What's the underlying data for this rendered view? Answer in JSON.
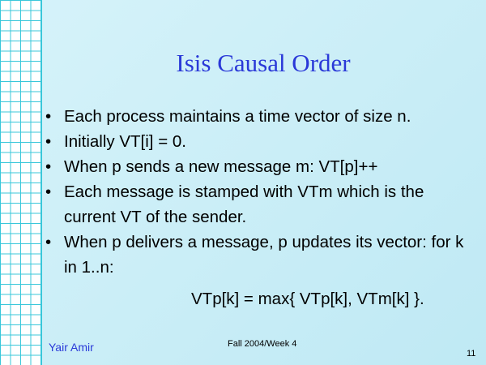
{
  "slide": {
    "title": "Isis Causal Order",
    "bullet_glyph": "•",
    "bullets": [
      "Each process maintains a time vector of size n.",
      "Initially VT[i] = 0.",
      "When p sends a new message m: VT[p]++",
      "Each message is stamped with VTm which is the current VT of the sender.",
      "When p delivers a message, p updates its vector: for k in 1..n:"
    ],
    "formula": "VTp[k] = max{ VTp[k], VTm[k] }.",
    "footer": {
      "author": "Yair Amir",
      "date": "Fall 2004/Week 4",
      "page_number": "11"
    }
  },
  "colors": {
    "background": "#c9eef7",
    "grid_line": "#39c7da",
    "title": "#2a39d8",
    "author": "#2a39d8"
  }
}
